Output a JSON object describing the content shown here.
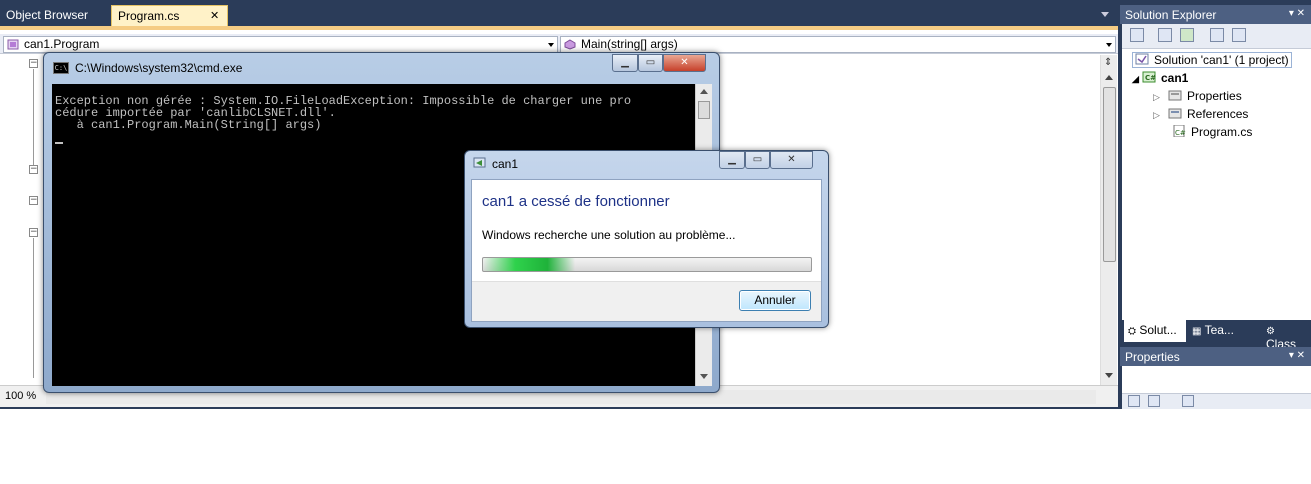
{
  "vs": {
    "tabs": [
      {
        "label": "Object Browser"
      },
      {
        "label": "Program.cs"
      }
    ],
    "tab_close": "✕",
    "nav": {
      "class_combo": "can1.Program",
      "member_combo": "Main(string[] args)"
    },
    "zoom": "100 %"
  },
  "solution_explorer": {
    "title": "Solution Explorer",
    "pin": "▾ ✕",
    "items": [
      {
        "label": "Solution 'can1' (1 project)"
      },
      {
        "label": "can1"
      },
      {
        "label": "Properties"
      },
      {
        "label": "References"
      },
      {
        "label": "Program.cs"
      }
    ],
    "bottom_tabs": [
      {
        "label": "Solut..."
      },
      {
        "label": "Tea..."
      },
      {
        "label": "Class"
      }
    ]
  },
  "properties": {
    "title": "Properties",
    "pin": "▾ ✕"
  },
  "cmd": {
    "title": "C:\\Windows\\system32\\cmd.exe",
    "lines": [
      "Exception non gérée : System.IO.FileLoadException: Impossible de charger une pro",
      "cédure importée par 'canlibCLSNET.dll'.",
      "   à can1.Program.Main(String[] args)"
    ],
    "minimize": "▁",
    "maximize": "▭",
    "close": "✕"
  },
  "dialog": {
    "title": "can1",
    "heading": "can1 a cessé de fonctionner",
    "message": "Windows recherche une solution au problème...",
    "cancel_label": "Annuler",
    "progress": 0.28,
    "minimize": "▁",
    "maximize": "▭",
    "close": "✕"
  }
}
